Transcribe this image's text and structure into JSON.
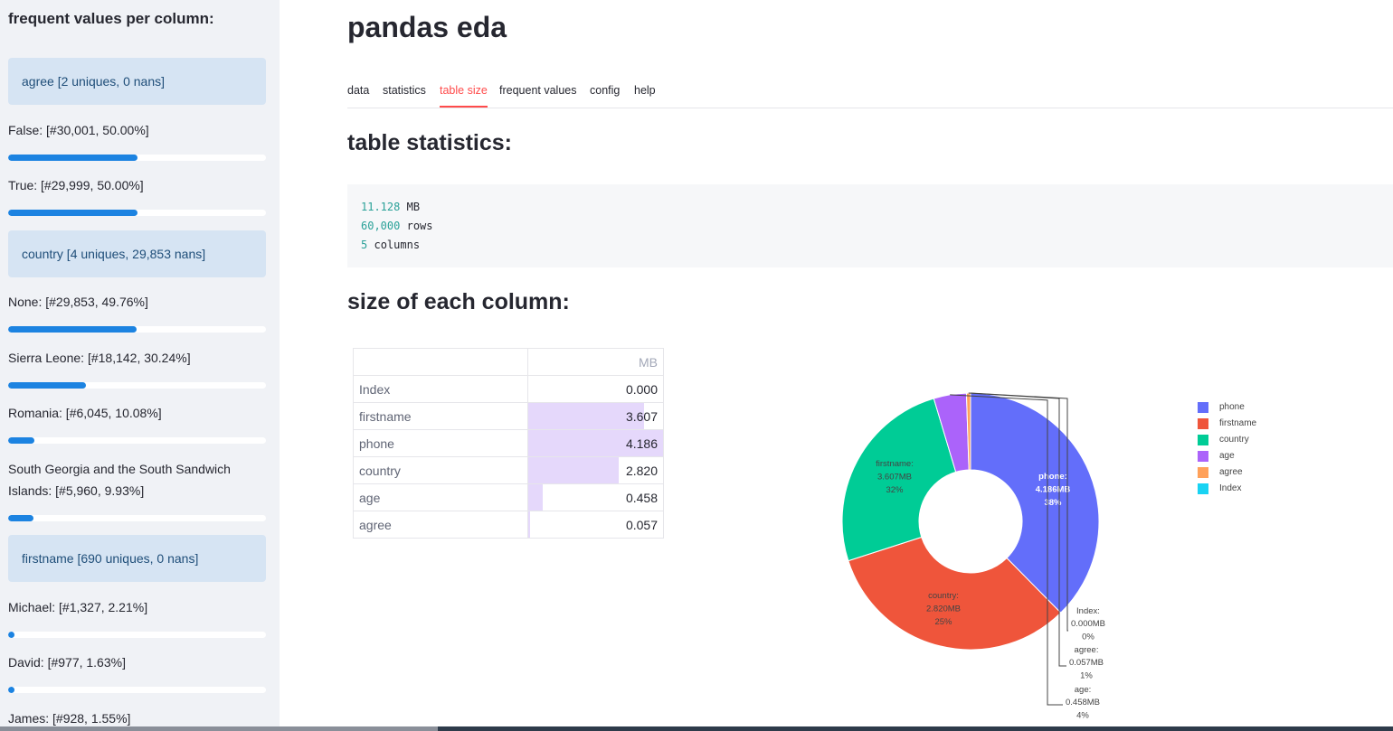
{
  "sidebar": {
    "title": "frequent values per column:",
    "groups": [
      {
        "header": "agree [2 uniques, 0 nans]",
        "values": [
          {
            "label": "False: [#30,001, 50.00%]",
            "fraction": 0.5
          },
          {
            "label": "True: [#29,999, 50.00%]",
            "fraction": 0.5
          }
        ]
      },
      {
        "header": "country [4 uniques, 29,853 nans]",
        "values": [
          {
            "label": "None: [#29,853, 49.76%]",
            "fraction": 0.4976
          },
          {
            "label": "Sierra Leone: [#18,142, 30.24%]",
            "fraction": 0.3024
          },
          {
            "label": "Romania: [#6,045, 10.08%]",
            "fraction": 0.1008
          },
          {
            "label": "South Georgia and the South Sandwich Islands: [#5,960, 9.93%]",
            "fraction": 0.0993
          }
        ]
      },
      {
        "header": "firstname [690 uniques, 0 nans]",
        "values": [
          {
            "label": "Michael: [#1,327, 2.21%]",
            "fraction": 0.0221
          },
          {
            "label": "David: [#977, 1.63%]",
            "fraction": 0.0163
          },
          {
            "label": "James: [#928, 1.55%]",
            "fraction": 0.0155
          }
        ]
      }
    ]
  },
  "main": {
    "title": "pandas eda",
    "tabs": [
      "data",
      "statistics",
      "table size",
      "frequent values",
      "config",
      "help"
    ],
    "active_tab": "table size",
    "table_statistics_heading": "table statistics:",
    "stats": {
      "size_value": "11.128",
      "size_unit": "MB",
      "rows_value": "60,000",
      "rows_unit": "rows",
      "cols_value": "5",
      "cols_unit": "columns"
    },
    "size_heading": "size of each column:",
    "size_table": {
      "column_header": "MB",
      "rows": [
        {
          "label": "Index",
          "value": "0.000",
          "num": 0.0
        },
        {
          "label": "firstname",
          "value": "3.607",
          "num": 3.607
        },
        {
          "label": "phone",
          "value": "4.186",
          "num": 4.186
        },
        {
          "label": "country",
          "value": "2.820",
          "num": 2.82
        },
        {
          "label": "age",
          "value": "0.458",
          "num": 0.458
        },
        {
          "label": "agree",
          "value": "0.057",
          "num": 0.057
        }
      ]
    }
  },
  "chart_data": {
    "type": "pie",
    "hole": true,
    "slices": [
      {
        "label": "phone",
        "value": 4.186,
        "text": [
          "phone:",
          "4.186MB",
          "38%"
        ],
        "color": "#636efa"
      },
      {
        "label": "firstname",
        "value": 3.607,
        "text": [
          "firstname:",
          "3.607MB",
          "32%"
        ],
        "color": "#ef553b"
      },
      {
        "label": "country",
        "value": 2.82,
        "text": [
          "country:",
          "2.820MB",
          "25%"
        ],
        "color": "#00cc96"
      },
      {
        "label": "age",
        "value": 0.458,
        "text": [
          "age:",
          "0.458MB",
          "4%"
        ],
        "color": "#ab63fa"
      },
      {
        "label": "agree",
        "value": 0.057,
        "text": [
          "agree:",
          "0.057MB",
          "1%"
        ],
        "color": "#ffa15a"
      },
      {
        "label": "Index",
        "value": 0.0,
        "text": [
          "Index:",
          "0.000MB",
          "0%"
        ],
        "color": "#19d3f3"
      }
    ],
    "legend": [
      "phone",
      "firstname",
      "country",
      "age",
      "agree",
      "Index"
    ],
    "legend_position": "right"
  }
}
